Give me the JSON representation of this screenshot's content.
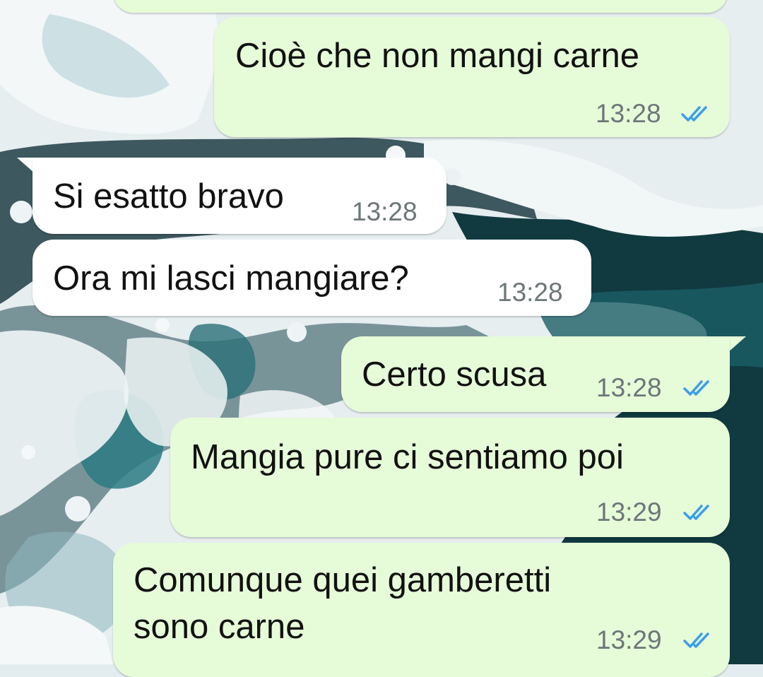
{
  "chat": {
    "messages": [
      {
        "direction": "outgoing",
        "text": "Cioè che non mangi carne",
        "time": "13:28",
        "status": "read-ticks-icon"
      },
      {
        "direction": "incoming",
        "text": "Si esatto bravo",
        "time": "13:28"
      },
      {
        "direction": "incoming",
        "text": "Ora mi lasci mangiare?",
        "time": "13:28"
      },
      {
        "direction": "outgoing",
        "text": "Certo scusa",
        "time": "13:28",
        "status": "read-ticks-icon"
      },
      {
        "direction": "outgoing",
        "text": "Mangia pure ci sentiamo poi",
        "time": "13:29",
        "status": "read-ticks-icon"
      },
      {
        "direction": "outgoing",
        "text_line1": "Comunque quei gamberetti",
        "text_line2": "sono carne",
        "time": "13:29",
        "status": "read-ticks-icon"
      }
    ]
  },
  "colors": {
    "outgoing_bubble": "#e6fbd8",
    "incoming_bubble": "#ffffff",
    "read_tick": "#3c9ee8",
    "timestamp": "#6e7679"
  }
}
